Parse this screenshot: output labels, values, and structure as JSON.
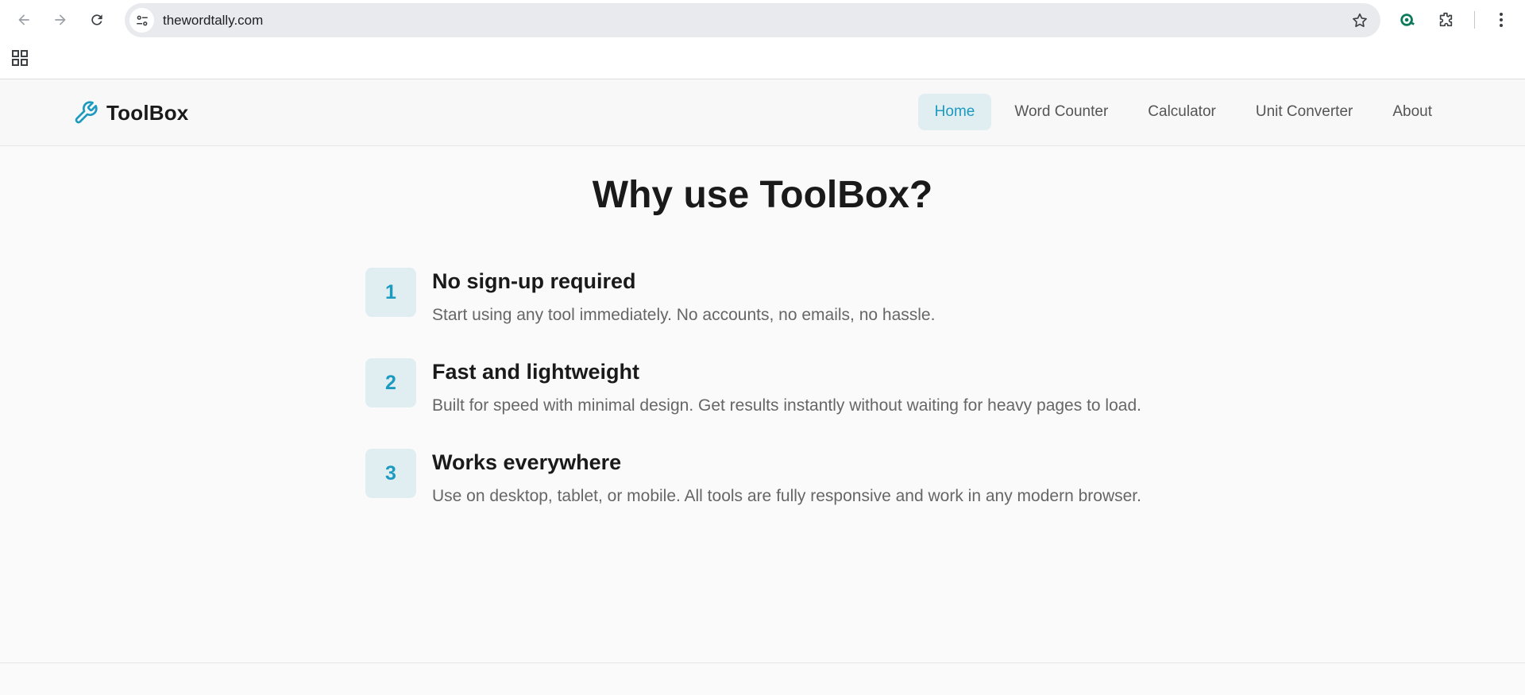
{
  "browser": {
    "url": "thewordtally.com"
  },
  "site": {
    "logo_text": "ToolBox",
    "accent_color": "#1d9ac0",
    "nav": [
      {
        "label": "Home",
        "active": true
      },
      {
        "label": "Word Counter",
        "active": false
      },
      {
        "label": "Calculator",
        "active": false
      },
      {
        "label": "Unit Converter",
        "active": false
      },
      {
        "label": "About",
        "active": false
      }
    ]
  },
  "main": {
    "title": "Why use ToolBox?",
    "features": [
      {
        "number": "1",
        "title": "No sign-up required",
        "description": "Start using any tool immediately. No accounts, no emails, no hassle."
      },
      {
        "number": "2",
        "title": "Fast and lightweight",
        "description": "Built for speed with minimal design. Get results instantly without waiting for heavy pages to load."
      },
      {
        "number": "3",
        "title": "Works everywhere",
        "description": "Use on desktop, tablet, or mobile. All tools are fully responsive and work in any modern browser."
      }
    ]
  }
}
